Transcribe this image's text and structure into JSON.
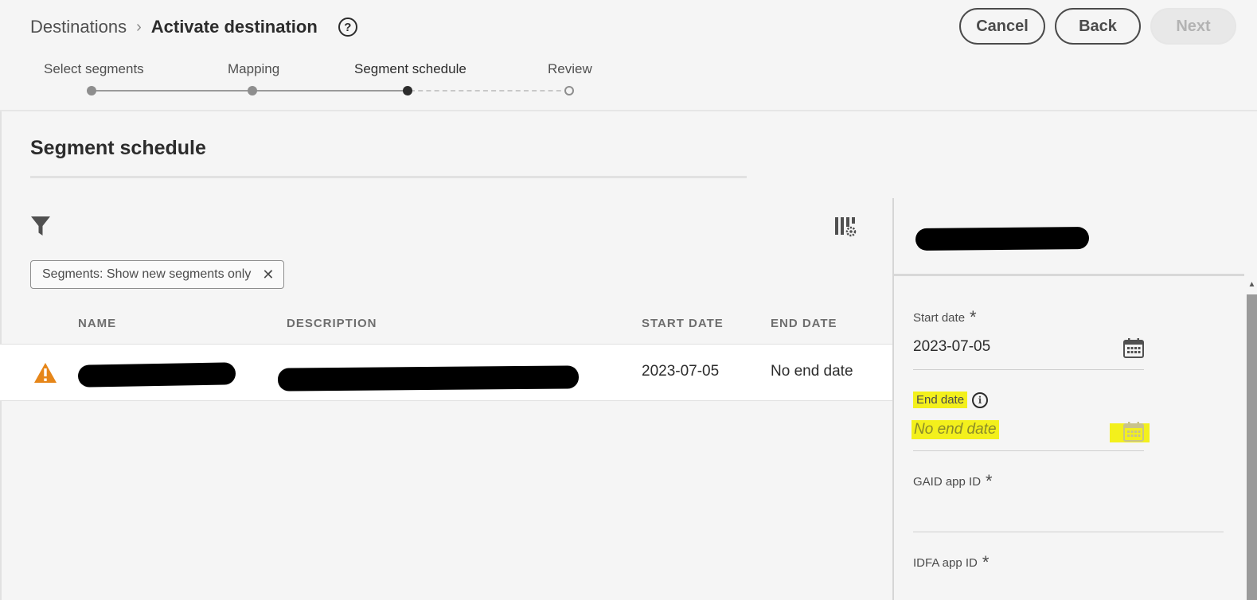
{
  "breadcrumb": {
    "parent": "Destinations",
    "separator": "›",
    "current": "Activate destination",
    "help": "?"
  },
  "header_buttons": {
    "cancel": "Cancel",
    "back": "Back",
    "next": "Next"
  },
  "stepper": {
    "steps": [
      "Select segments",
      "Mapping",
      "Segment schedule",
      "Review"
    ],
    "current_index": 2
  },
  "section": {
    "title": "Segment schedule"
  },
  "filter_chip": {
    "label": "Segments: Show new segments only",
    "close": "✕"
  },
  "table": {
    "columns": [
      "NAME",
      "DESCRIPTION",
      "START DATE",
      "END DATE"
    ],
    "rows": [
      {
        "start_date": "2023-07-05",
        "end_date": "No end date"
      }
    ]
  },
  "panel": {
    "start_date": {
      "label": "Start date",
      "required": "*",
      "value": "2023-07-05"
    },
    "end_date": {
      "label": "End date",
      "info": "i",
      "placeholder": "No end date"
    },
    "gaid": {
      "label": "GAID app ID",
      "required": "*"
    },
    "idfa": {
      "label": "IDFA app ID",
      "required": "*"
    }
  },
  "colors": {
    "highlight": "#f3f01c",
    "warning": "#e68619",
    "disabled_button": "#e8e8e8"
  }
}
